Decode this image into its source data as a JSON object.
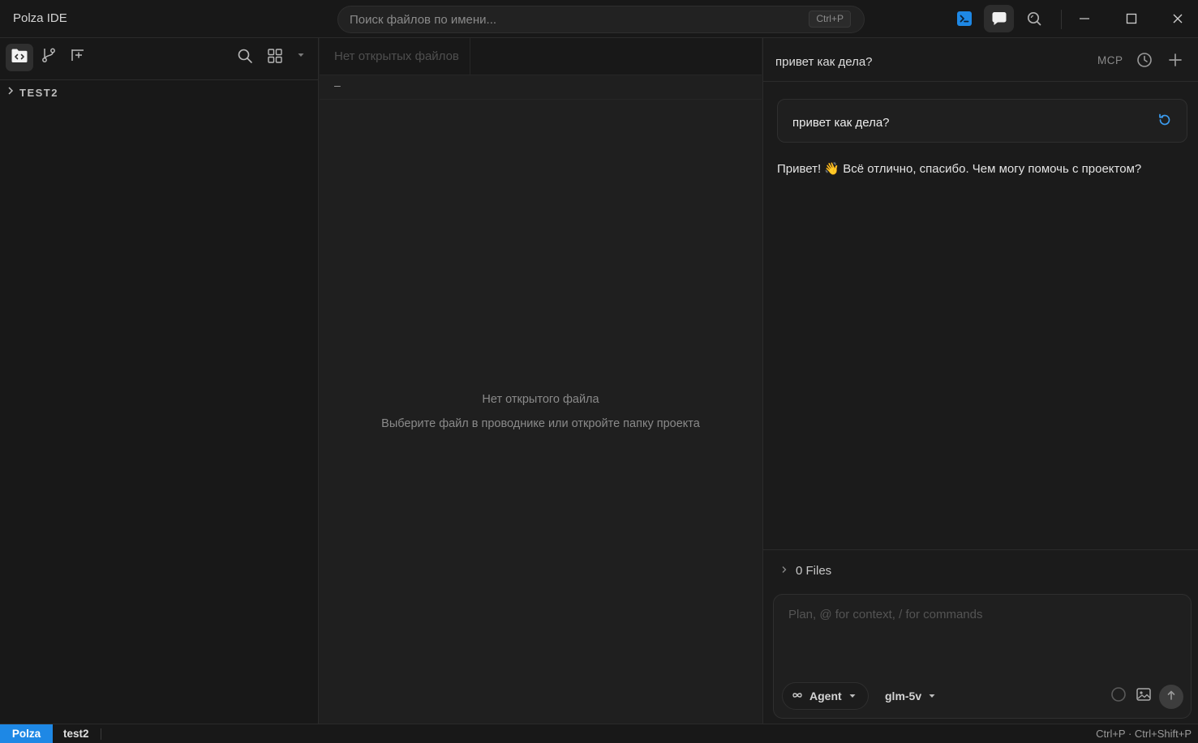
{
  "window": {
    "title": "Polza IDE",
    "search_placeholder": "Поиск файлов по имени...",
    "search_shortcut": "Ctrl+P"
  },
  "icons": {
    "terminal": "terminal-icon",
    "chat": "chat-bubble-icon",
    "search": "search-icon",
    "minimize": "minimize-icon",
    "maximize": "maximize-icon",
    "close": "close-icon"
  },
  "sidebar": {
    "root_folder": "TEST2",
    "icons": [
      "explorer-icon",
      "git-branch-icon",
      "new-file-icon",
      "search-icon",
      "grid-icon",
      "caret-down-icon"
    ]
  },
  "editor": {
    "no_tabs_label": "Нет открытых файлов",
    "breadcrumb": "–",
    "empty_title": "Нет открытого файла",
    "empty_subtitle": "Выберите файл в проводнике или откройте папку проекта"
  },
  "chat": {
    "title": "привет как дела?",
    "mcp_label": "MCP",
    "user_message": "привет как дела?",
    "assistant_message": "Привет! 👋 Всё отлично, спасибо. Чем могу помочь с проектом?",
    "files_label": "0 Files",
    "composer_placeholder": "Plan, @ for context, / for commands",
    "mode_label": "Agent",
    "model_label": "glm-5v"
  },
  "statusbar": {
    "brand": "Polza",
    "project": "test2",
    "shortcuts": "Ctrl+P · Ctrl+Shift+P"
  },
  "colors": {
    "accent": "#1e88e5",
    "terminal_icon_bg": "#1e88e5",
    "retry_icon": "#3b9cf0",
    "background": "#1f1f1f",
    "panel": "#181818"
  }
}
